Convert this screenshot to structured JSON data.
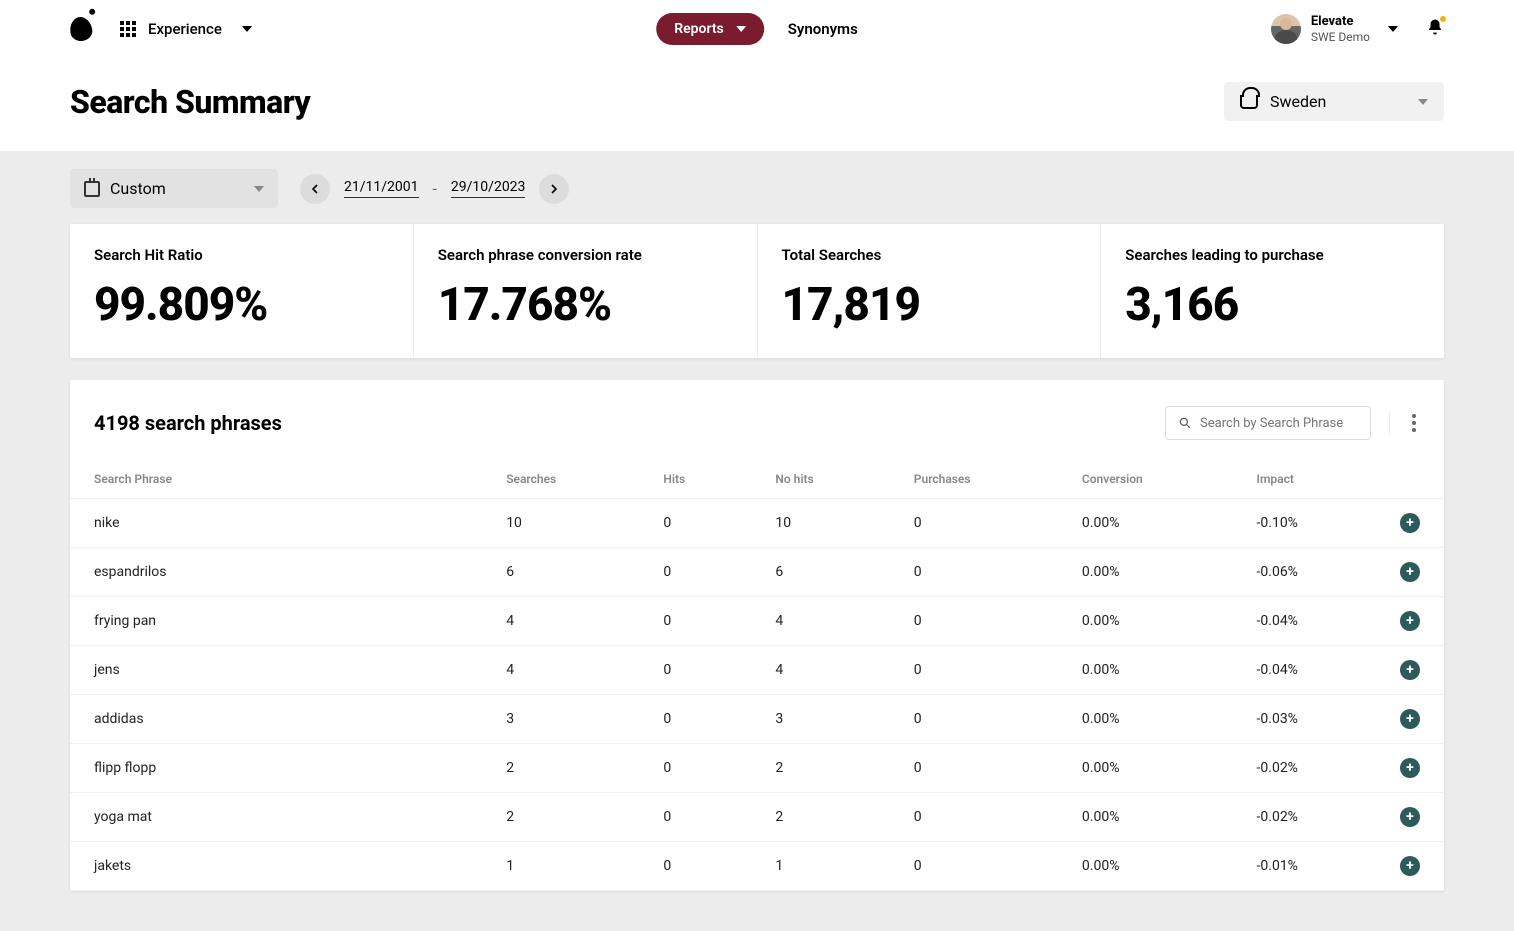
{
  "nav": {
    "experience_label": "Experience",
    "reports_label": "Reports",
    "synonyms_label": "Synonyms"
  },
  "user": {
    "name": "Elevate",
    "org": "SWE Demo"
  },
  "page": {
    "title": "Search Summary"
  },
  "market": {
    "selected": "Sweden"
  },
  "date_range": {
    "preset": "Custom",
    "from": "21/11/2001",
    "to": "29/10/2023",
    "separator": "-"
  },
  "stats": [
    {
      "label": "Search Hit Ratio",
      "value": "99.809%"
    },
    {
      "label": "Search phrase conversion rate",
      "value": "17.768%"
    },
    {
      "label": "Total Searches",
      "value": "17,819"
    },
    {
      "label": "Searches leading to purchase",
      "value": "3,166"
    }
  ],
  "table": {
    "title": "4198 search phrases",
    "search_placeholder": "Search by Search Phrase",
    "columns": [
      "Search Phrase",
      "Searches",
      "Hits",
      "No hits",
      "Purchases",
      "Conversion",
      "Impact",
      ""
    ],
    "rows": [
      {
        "phrase": "nike",
        "searches": "10",
        "hits": "0",
        "no_hits": "10",
        "purchases": "0",
        "conversion": "0.00%",
        "impact": "-0.10%"
      },
      {
        "phrase": "espandrilos",
        "searches": "6",
        "hits": "0",
        "no_hits": "6",
        "purchases": "0",
        "conversion": "0.00%",
        "impact": "-0.06%"
      },
      {
        "phrase": "frying pan",
        "searches": "4",
        "hits": "0",
        "no_hits": "4",
        "purchases": "0",
        "conversion": "0.00%",
        "impact": "-0.04%"
      },
      {
        "phrase": "jens",
        "searches": "4",
        "hits": "0",
        "no_hits": "4",
        "purchases": "0",
        "conversion": "0.00%",
        "impact": "-0.04%"
      },
      {
        "phrase": "addidas",
        "searches": "3",
        "hits": "0",
        "no_hits": "3",
        "purchases": "0",
        "conversion": "0.00%",
        "impact": "-0.03%"
      },
      {
        "phrase": "flipp flopp",
        "searches": "2",
        "hits": "0",
        "no_hits": "2",
        "purchases": "0",
        "conversion": "0.00%",
        "impact": "-0.02%"
      },
      {
        "phrase": "yoga mat",
        "searches": "2",
        "hits": "0",
        "no_hits": "2",
        "purchases": "0",
        "conversion": "0.00%",
        "impact": "-0.02%"
      },
      {
        "phrase": "jakets",
        "searches": "1",
        "hits": "0",
        "no_hits": "1",
        "purchases": "0",
        "conversion": "0.00%",
        "impact": "-0.01%"
      }
    ]
  }
}
